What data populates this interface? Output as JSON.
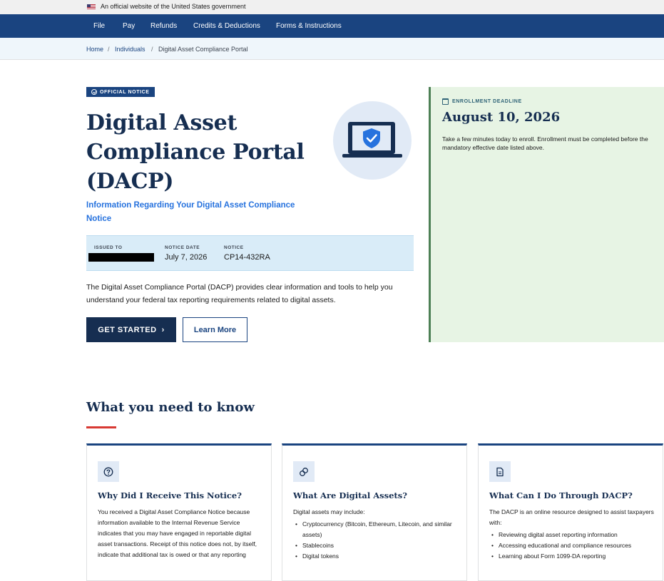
{
  "gov_banner": {
    "text": "An official website of the United States government"
  },
  "nav": {
    "items": [
      "File",
      "Pay",
      "Refunds",
      "Credits & Deductions",
      "Forms & Instructions"
    ]
  },
  "breadcrumb": {
    "home": "Home",
    "individuals": "Individuals",
    "current": "Digital Asset Compliance Portal",
    "separator": "/"
  },
  "hero": {
    "badge": "OFFICIAL NOTICE",
    "title": "Digital Asset Compliance Portal (DACP)",
    "subtitle": "Information Regarding Your Digital Asset Compliance Notice",
    "notice_info": {
      "issued_to_label": "ISSUED TO",
      "notice_date_label": "NOTICE DATE",
      "notice_date": "July 7, 2026",
      "notice_label": "NOTICE",
      "notice_number": "CP14-432RA"
    },
    "intro": "The Digital Asset Compliance Portal (DACP) provides clear information and tools to help you understand your federal tax reporting requirements related to digital assets.",
    "primary_button": "GET STARTED",
    "primary_button_arrow": "›",
    "secondary_button": "Learn More",
    "icon": "laptop-shield-icon"
  },
  "deadline": {
    "label": "ENROLLMENT DEADLINE",
    "date": "August 10, 2026",
    "text": "Take a few minutes today to enroll. Enrollment must be completed before the mandatory effective date listed above."
  },
  "section": {
    "title": "What you need to know",
    "cards": [
      {
        "icon": "question-icon",
        "title": "Why Did I Receive This Notice?",
        "body": "You received a Digital Asset Compliance Notice because information available to the Internal Revenue Service indicates that you may have engaged in reportable digital asset transactions. Receipt of this notice does not, by itself, indicate that additional tax is owed or that any reporting"
      },
      {
        "icon": "link-icon",
        "title": "What Are Digital Assets?",
        "body": "Digital assets may include:",
        "bullets": [
          "Cryptocurrency (Bitcoin, Ethereum, Litecoin, and similar assets)",
          "Stablecoins",
          "Digital tokens"
        ]
      },
      {
        "icon": "document-icon",
        "title": "What Can I Do Through DACP?",
        "body": "The DACP is an online resource designed to assist taxpayers with:",
        "bullets": [
          "Reviewing digital asset reporting information",
          "Accessing educational and compliance resources",
          "Learning about Form 1099-DA reporting"
        ]
      }
    ]
  },
  "colors": {
    "navy": "#162e51",
    "nav_blue": "#1a4480",
    "link_blue": "#2672de",
    "accent_red": "#d83933",
    "deadline_green": "#e7f4e4"
  }
}
